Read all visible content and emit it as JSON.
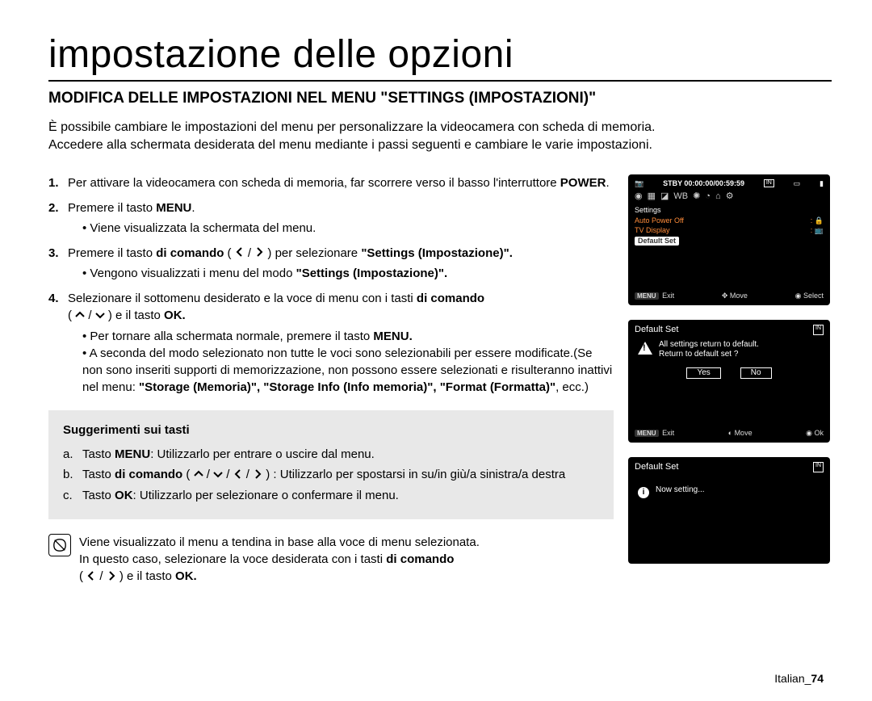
{
  "title": "impostazione delle opzioni",
  "section_heading": "MODIFICA DELLE IMPOSTAZIONI NEL MENU \"SETTINGS (IMPOSTAZIONI)\"",
  "intro_line1": "È possibile cambiare le impostazioni del menu per personalizzare la videocamera con scheda di memoria.",
  "intro_line2": "Accedere alla schermata desiderata del menu mediante i passi seguenti e cambiare le varie impostazioni.",
  "steps": {
    "n1": "1.",
    "s1_pre": "Per attivare la videocamera con scheda di memoria, far scorrere verso il basso l'interruttore ",
    "s1_b": "POWER",
    "s1_post": ".",
    "n2": "2.",
    "s2_pre": "Premere il tasto ",
    "s2_b": "MENU",
    "s2_post": ".",
    "s2_sub": "Viene visualizzata la schermata del menu.",
    "n3": "3.",
    "s3_pre": "Premere il tasto ",
    "s3_b1": "di comando",
    "s3_mid1": " ( ",
    "s3_mid2": " / ",
    "s3_mid3": " ) per selezionare ",
    "s3_b2": "\"Settings (Impostazione)\".",
    "s3_sub_pre": "Vengono visualizzati i menu del modo ",
    "s3_sub_b": "\"Settings (Impostazione)\".",
    "n4": "4.",
    "s4_pre": "Selezionare il sottomenu desiderato e la voce di menu con i tasti  ",
    "s4_b1": "di comando",
    "s4_mid1": " ( ",
    "s4_mid2": " / ",
    "s4_mid3": " ) e il tasto ",
    "s4_b2": "OK.",
    "s4_sub1_pre": "Per tornare alla schermata normale, premere il tasto ",
    "s4_sub1_b": "MENU.",
    "s4_sub2_pre": "A seconda del modo selezionato non tutte le voci sono selezionabili per essere modificate.(Se non sono inseriti supporti di memorizzazione, non possono essere selezionati e risulteranno inattivi nel menu: ",
    "s4_sub2_b1": "\"Storage (Memoria)\", \"Storage Info (Info memoria)\", \"Format (Formatta)\"",
    "s4_sub2_post": ", ecc.)"
  },
  "tips": {
    "title": "Suggerimenti sui tasti",
    "la": "a.",
    "a_pre": "Tasto ",
    "a_b": "MENU",
    "a_post": ": Utilizzarlo per entrare o uscire dal menu.",
    "lb": "b.",
    "b_pre": "Tasto ",
    "b_b": "di comando",
    "b_mid1": " ( ",
    "b_sep": " / ",
    "b_mid2": " ) : Utilizzarlo per spostarsi in su/in giù/a sinistra/a destra",
    "lc": "c.",
    "c_pre": "Tasto ",
    "c_b": "OK",
    "c_post": ": Utilizzarlo per selezionare o confermare il menu."
  },
  "note": {
    "line1_pre": "Viene visualizzato il menu a tendina in base alla voce di menu selezionata.",
    "line2_pre": "In questo caso, selezionare la voce desiderata con i tasti ",
    "line2_b": "di comando",
    "line3_pre": "( ",
    "line3_sep": " / ",
    "line3_mid": " ) e il tasto ",
    "line3_b": "OK."
  },
  "screen1": {
    "status": "STBY 00:00:00/00:59:59",
    "in": "IN",
    "settings": "Settings",
    "item1": "Auto Power Off",
    "item2": "TV Display",
    "item3": "Default Set",
    "f_exit": "Exit",
    "f_move": "Move",
    "f_select": "Select",
    "menu_tag": "MENU"
  },
  "screen2": {
    "title": "Default Set",
    "in": "IN",
    "msg1": "All settings return to default.",
    "msg2": "Return to default set ?",
    "yes": "Yes",
    "no": "No",
    "f_exit": "Exit",
    "f_move": "Move",
    "f_ok": "Ok",
    "menu_tag": "MENU"
  },
  "screen3": {
    "title": "Default Set",
    "in": "IN",
    "msg": "Now setting..."
  },
  "page_label": "Italian_",
  "page_num": "74"
}
